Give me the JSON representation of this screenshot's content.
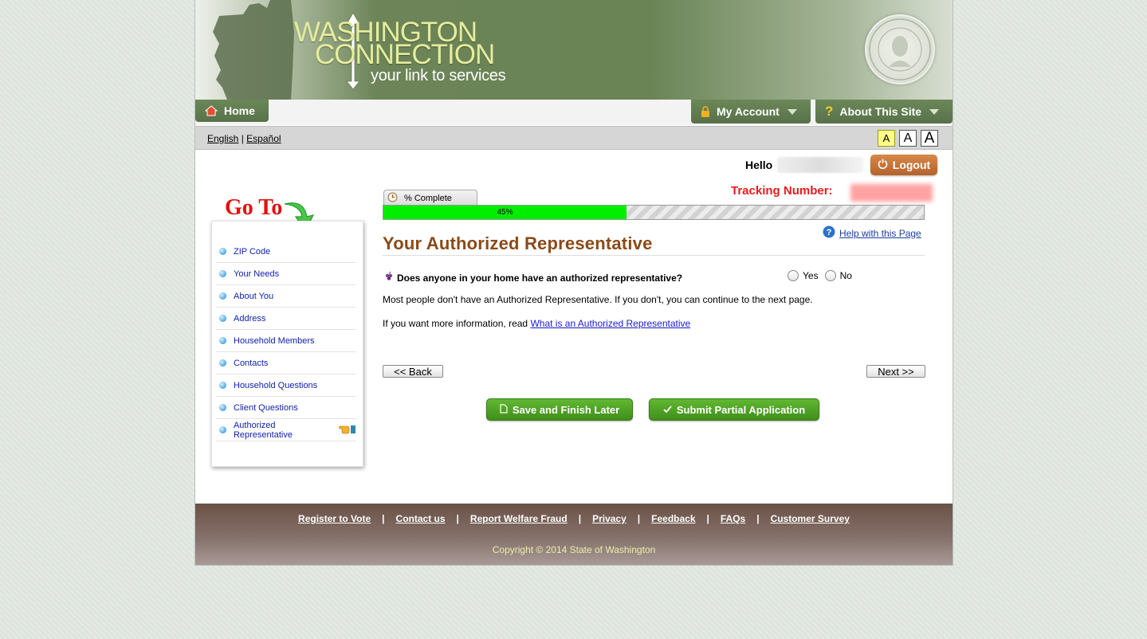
{
  "banner": {
    "logo_line1": "WASHINGTON",
    "logo_line2": "CONNECTION",
    "tagline": "your link to services",
    "seal_name": "washington-state-seal"
  },
  "nav": {
    "home": "Home",
    "my_account": "My Account",
    "about": "About This Site"
  },
  "lang": {
    "english": "English",
    "spanish": "Español",
    "separator": "|",
    "font_sizes": [
      "A",
      "A",
      "A"
    ]
  },
  "user": {
    "greeting": "Hello",
    "logout": "Logout"
  },
  "sidebar": {
    "goto_label": "Go To",
    "items": [
      "ZIP Code",
      "Your Needs",
      "About You",
      "Address",
      "Household Members",
      "Contacts",
      "Household Questions",
      "Client Questions",
      "Authorized Representative"
    ]
  },
  "progress": {
    "tab_label": "% Complete",
    "percent": 45,
    "percent_label": "45%",
    "tracking_label": "Tracking Number:"
  },
  "main": {
    "heading": "Your Authorized Representative",
    "help_link": "Help with this Page",
    "question": "Does anyone in your home have an authorized representative?",
    "yes_label": "Yes",
    "no_label": "No",
    "info1": "Most people don't have an Authorized Representative. If you don't, you can continue to the next page.",
    "info2_prefix": "If you want more information, read",
    "info2_link": "What is an Authorized Representative",
    "back_button": "<< Back",
    "next_button": "Next >>",
    "save_button": "Save and Finish Later",
    "submit_button": "Submit Partial Application"
  },
  "footer": {
    "links": [
      "Register to Vote",
      "Contact us",
      "Report Welfare Fraud",
      "Privacy",
      "Feedback",
      "FAQs",
      "Customer Survey"
    ],
    "separator": "|",
    "copyright": "Copyright © 2014 State of Washington"
  },
  "colors": {
    "banner_green": "#6a8456",
    "heading_brown": "#8a4a18",
    "progress_green": "#00ee00",
    "tracking_red": "#e61c1c",
    "link_blue": "#1020b0",
    "footer_brown": "#6a5246"
  }
}
